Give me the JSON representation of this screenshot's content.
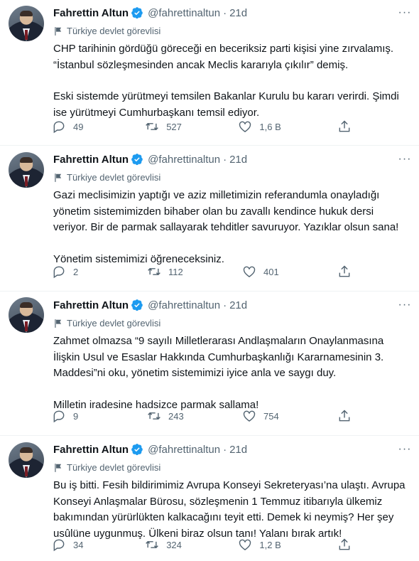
{
  "tweets": [
    {
      "author": "Fahrettin Altun",
      "handle": "@fahrettinaltun",
      "time": "21d",
      "label": "Türkiye devlet görevlisi",
      "paragraphs": [
        "CHP tarihinin gördüğü göreceği en beceriksiz parti kişisi yine zırvalamış. “İstanbul sözleşmesinden ancak Meclis kararıyla çıkılır” demiş.",
        "Eski sistemde yürütmeyi temsilen Bakanlar Kurulu bu kararı verirdi. Şimdi ise yürütmeyi Cumhurbaşkanı temsil ediyor."
      ],
      "replies": "49",
      "retweets": "527",
      "likes": "1,6 B"
    },
    {
      "author": "Fahrettin Altun",
      "handle": "@fahrettinaltun",
      "time": "21d",
      "label": "Türkiye devlet görevlisi",
      "paragraphs": [
        "Gazi meclisimizin yaptığı ve aziz milletimizin referandumla onayladığı yönetim sistemimizden bihaber olan bu zavallı kendince hukuk dersi veriyor. Bir de parmak sallayarak tehditler savuruyor. Yazıklar olsun sana!",
        "Yönetim sistemimizi öğreneceksiniz."
      ],
      "replies": "2",
      "retweets": "112",
      "likes": "401"
    },
    {
      "author": "Fahrettin Altun",
      "handle": "@fahrettinaltun",
      "time": "21d",
      "label": "Türkiye devlet görevlisi",
      "paragraphs": [
        "Zahmet olmazsa “9 sayılı Milletlerarası Andlaşmaların Onaylanmasına İlişkin Usul ve Esaslar Hakkında Cumhurbaşkanlığı Kararnamesinin 3. Maddesi”ni oku, yönetim sistemimizi iyice anla ve saygı duy.",
        "Milletin iradesine hadsizce parmak sallama!"
      ],
      "replies": "9",
      "retweets": "243",
      "likes": "754"
    },
    {
      "author": "Fahrettin Altun",
      "handle": "@fahrettinaltun",
      "time": "21d",
      "label": "Türkiye devlet görevlisi",
      "paragraphs": [
        "Bu iş bitti. Fesih bildirimimiz Avrupa Konseyi Sekreteryası’na ulaştı. Avrupa Konseyi Anlaşmalar Bürosu, sözleşmenin 1 Temmuz itibarıyla ülkemiz bakımından yürürlükten kalkacağını teyit etti. Demek ki neymiş? Her şey usûlüne uygunmuş. Ülkeni biraz olsun tanı! Yalanı bırak artık!"
      ],
      "replies": "34",
      "retweets": "324",
      "likes": "1,2 B"
    }
  ],
  "colors": {
    "verified": "#1d9bf0",
    "muted": "#536471",
    "text": "#0f1419"
  }
}
